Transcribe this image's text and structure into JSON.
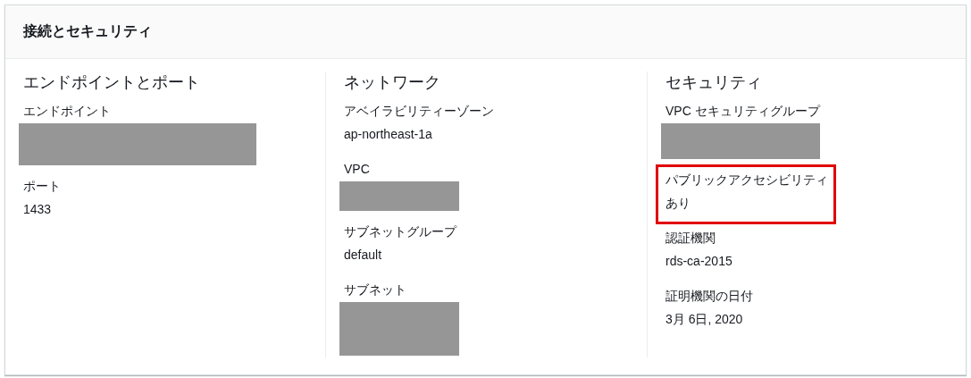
{
  "panel": {
    "title": "接続とセキュリティ"
  },
  "columns": [
    {
      "heading": "エンドポイントとポート",
      "fields": [
        {
          "label": "エンドポイント",
          "kind": "redacted",
          "highlighted": false
        },
        {
          "label": "ポート",
          "kind": "text",
          "value": "1433",
          "highlighted": false
        }
      ]
    },
    {
      "heading": "ネットワーク",
      "fields": [
        {
          "label": "アベイラビリティーゾーン",
          "kind": "text",
          "value": "ap-northeast-1a",
          "highlighted": false
        },
        {
          "label": "VPC",
          "kind": "redacted",
          "highlighted": false
        },
        {
          "label": "サブネットグループ",
          "kind": "text",
          "value": "default",
          "highlighted": false
        },
        {
          "label": "サブネット",
          "kind": "redacted",
          "highlighted": false
        }
      ]
    },
    {
      "heading": "セキュリティ",
      "fields": [
        {
          "label": "VPC セキュリティグループ",
          "kind": "redacted",
          "highlighted": false
        },
        {
          "label": "パブリックアクセシビリティ",
          "kind": "text",
          "value": "あり",
          "highlighted": true
        },
        {
          "label": "認証機関",
          "kind": "text",
          "value": "rds-ca-2015",
          "highlighted": false
        },
        {
          "label": "証明機関の日付",
          "kind": "text",
          "value": "3月 6日, 2020",
          "highlighted": false
        }
      ]
    }
  ]
}
